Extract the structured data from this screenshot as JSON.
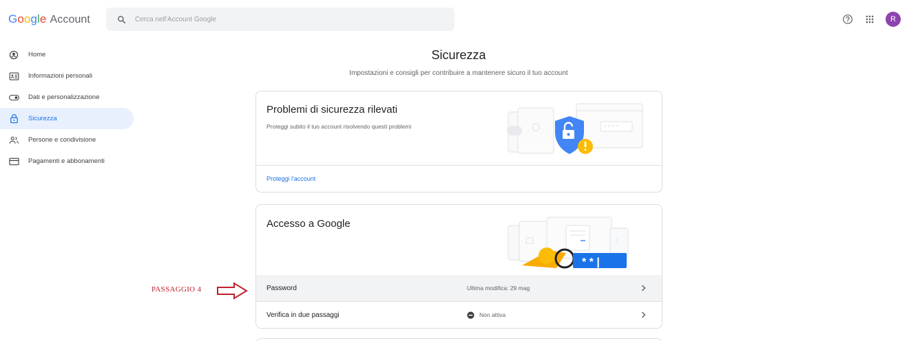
{
  "header": {
    "logo_google": [
      "G",
      "o",
      "o",
      "g",
      "l",
      "e"
    ],
    "logo_account": "Account",
    "search_placeholder": "Cerca nell'Account Google",
    "avatar_initial": "R"
  },
  "sidebar": {
    "items": [
      {
        "label": "Home",
        "icon": "home-person-icon"
      },
      {
        "label": "Informazioni personali",
        "icon": "id-card-icon"
      },
      {
        "label": "Dati e personalizzazione",
        "icon": "toggle-icon"
      },
      {
        "label": "Sicurezza",
        "icon": "lock-icon",
        "active": true
      },
      {
        "label": "Persone e condivisione",
        "icon": "people-icon"
      },
      {
        "label": "Pagamenti e abbonamenti",
        "icon": "credit-card-icon"
      }
    ]
  },
  "main": {
    "title": "Sicurezza",
    "subtitle": "Impostazioni e consigli per contribuire a mantenere sicuro il tuo account",
    "security_issues": {
      "title": "Problemi di sicurezza rilevati",
      "description": "Proteggi subito il tuo account risolvendo questi problemi",
      "link": "Proteggi l'account"
    },
    "signin": {
      "title": "Accesso a Google",
      "rows": [
        {
          "label": "Password",
          "value": "Ultima modifica: 29 mag"
        },
        {
          "label": "Verifica in due passaggi",
          "value": "Non attiva"
        }
      ]
    }
  },
  "annotation": {
    "text": "PASSAGGIO 4",
    "color": "#c0202a"
  },
  "colors": {
    "accent": "#1a73e8",
    "active_bg": "#e8f0fe",
    "avatar": "#8e44ad"
  }
}
